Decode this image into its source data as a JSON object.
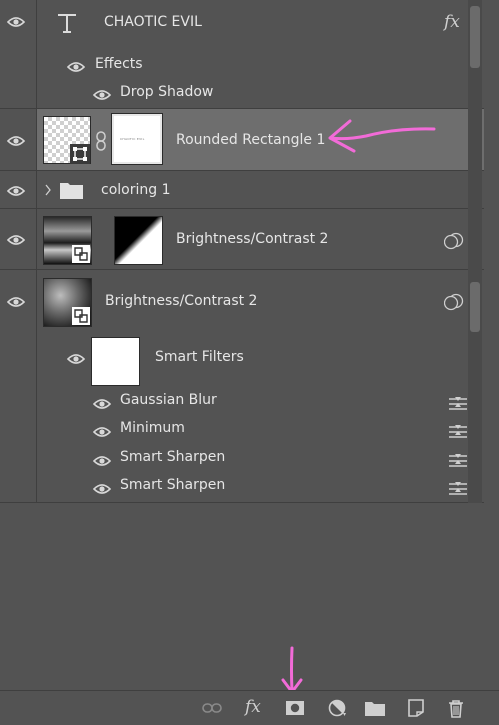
{
  "layers": {
    "text_layer": {
      "name": "CHAOTIC EVIL",
      "fx_label": "fx"
    },
    "effects_label": "Effects",
    "drop_shadow_label": "Drop Shadow",
    "rounded_rect": {
      "name": "Rounded Rectangle 1",
      "mask_text": "CHAOTIC EVIL"
    },
    "coloring_group": {
      "name": "coloring 1"
    },
    "bc_adjust": {
      "name": "Brightness/Contrast 2"
    },
    "bc_smart": {
      "name": "Brightness/Contrast 2"
    },
    "smart_filters_label": "Smart Filters",
    "filters": [
      "Gaussian Blur",
      "Minimum",
      "Smart Sharpen",
      "Smart Sharpen"
    ]
  },
  "bottom_toolbar": {
    "fx_label": "fx"
  },
  "colors": {
    "panel_bg": "#535353",
    "selected_bg": "#6e6e6e",
    "annotation": "#f26bd8"
  }
}
